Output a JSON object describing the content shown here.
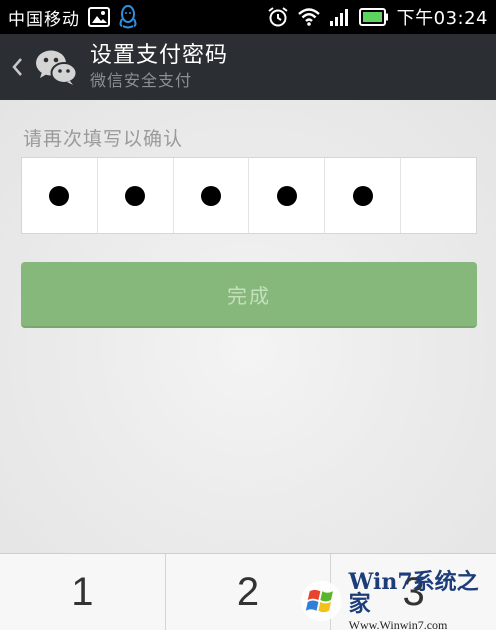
{
  "status_bar": {
    "carrier": "中国移动",
    "time": "下午03:24",
    "icons": [
      "image-icon",
      "qq-icon",
      "alarm-icon",
      "wifi-icon",
      "signal-icon",
      "battery-icon"
    ]
  },
  "title_bar": {
    "title": "设置支付密码",
    "subtitle": "微信安全支付"
  },
  "form": {
    "hint": "请再次填写以确认",
    "digits_entered": 5,
    "digits_total": 6,
    "done_label": "完成"
  },
  "keypad": {
    "keys": [
      "1",
      "2",
      "3"
    ]
  },
  "watermark": {
    "brand": "Win7系统之家",
    "url": "Www.Winwin7.com"
  },
  "colors": {
    "status_bar": "#000000",
    "title_bar": "#2b2f33",
    "background": "#ebebeb",
    "done_button": "#86b77b",
    "done_text": "#c4e0bd",
    "battery": "#5fd35f"
  }
}
